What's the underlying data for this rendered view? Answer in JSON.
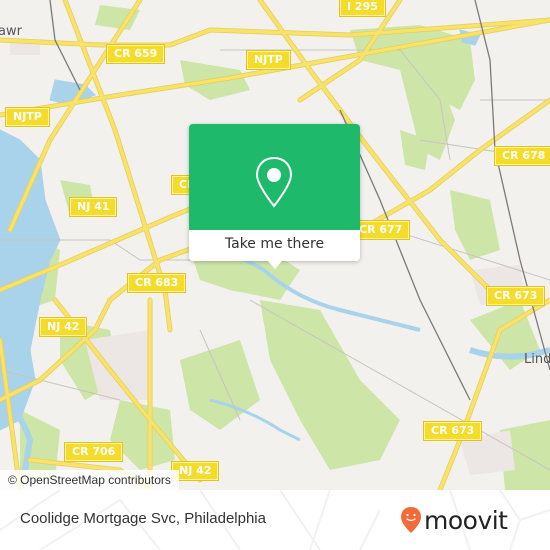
{
  "map": {
    "attribution": "© OpenStreetMap contributors",
    "road_labels": [
      {
        "id": "i295",
        "text": "I 295"
      },
      {
        "id": "cr659",
        "text": "CR 659"
      },
      {
        "id": "njtp-top",
        "text": "NJTP"
      },
      {
        "id": "njtp-left",
        "text": "NJTP"
      },
      {
        "id": "cr-partial",
        "text": "CR"
      },
      {
        "id": "nj41",
        "text": "NJ 41"
      },
      {
        "id": "cr678",
        "text": "CR 678"
      },
      {
        "id": "cr677",
        "text": "CR 677"
      },
      {
        "id": "cr683",
        "text": "CR 683"
      },
      {
        "id": "cr673-upper",
        "text": "CR 673"
      },
      {
        "id": "nj42-upper",
        "text": "NJ 42"
      },
      {
        "id": "cr673-lower",
        "text": "CR 673"
      },
      {
        "id": "cr706",
        "text": "CR 706"
      },
      {
        "id": "nj42-lower",
        "text": "NJ 42"
      }
    ],
    "place_labels": [
      {
        "id": "bellmawr",
        "text": "awr"
      },
      {
        "id": "lindenwold",
        "text": "Lind"
      }
    ],
    "colors": {
      "land": "#f2f1ee",
      "park": "#cde6a8",
      "water": "#a9d3ea",
      "road": "#f7e26b",
      "road_label_bg": "#f5dc2a",
      "rail": "#7a7a7a"
    }
  },
  "popup": {
    "icon": "map-pin-icon",
    "cta_label": "Take me there",
    "accent": "#1fb96c"
  },
  "footer": {
    "place_title": "Coolidge Mortgage Svc, Philadelphia",
    "brand": {
      "name": "moovit",
      "logo_icon": "moovit-pin-smile-icon",
      "logo_color": "#f26b3a"
    }
  }
}
